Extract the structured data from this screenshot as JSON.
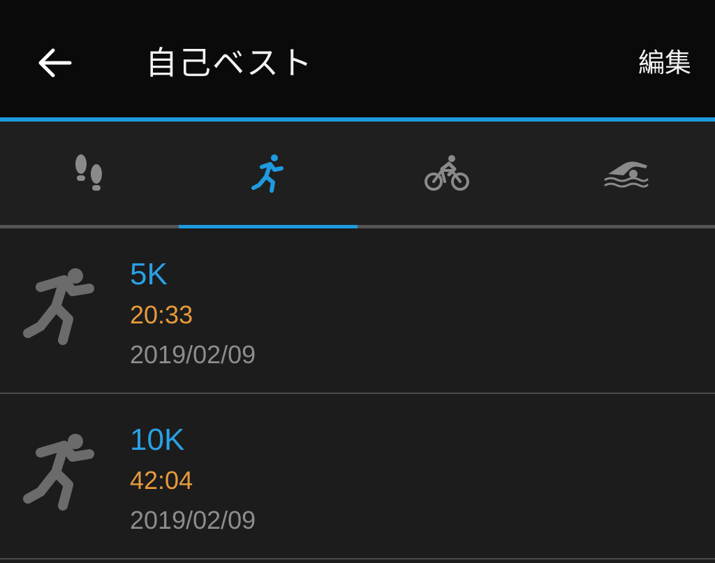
{
  "header": {
    "title": "自己ベスト",
    "edit_label": "編集"
  },
  "tabs": [
    {
      "icon": "footsteps-icon",
      "selected": false
    },
    {
      "icon": "running-icon",
      "selected": true
    },
    {
      "icon": "cycling-icon",
      "selected": false
    },
    {
      "icon": "swimming-icon",
      "selected": false
    }
  ],
  "colors": {
    "accent": "#1e9be0",
    "record_name": "#2aa0e4",
    "record_time": "#e69a3c",
    "record_date": "#8d8d8d"
  },
  "records": [
    {
      "name": "5K",
      "time": "20:33",
      "date": "2019/02/09",
      "icon": "runner-icon"
    },
    {
      "name": "10K",
      "time": "42:04",
      "date": "2019/02/09",
      "icon": "runner-icon"
    }
  ]
}
